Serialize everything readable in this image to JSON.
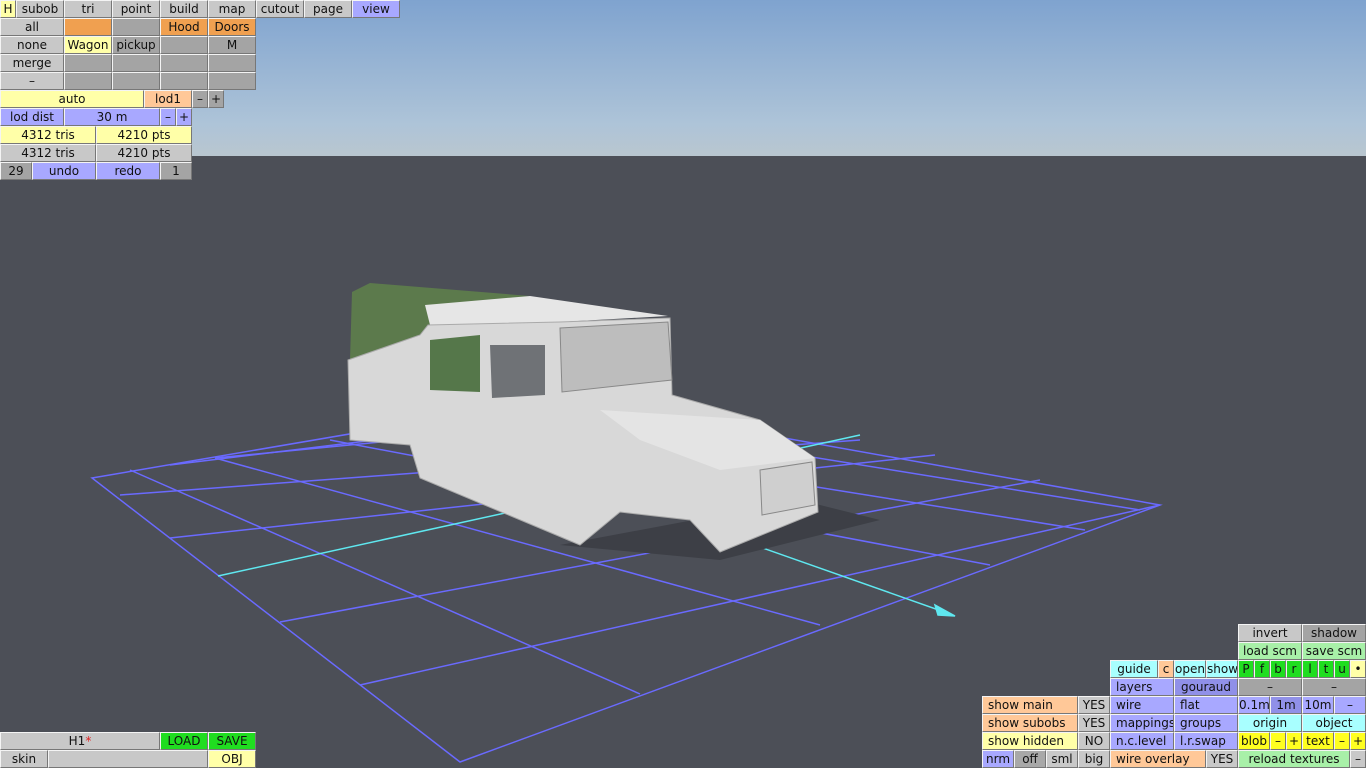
{
  "top_tabs": [
    "H",
    "subob",
    "tri",
    "point",
    "build",
    "map",
    "cutout",
    "page",
    "view"
  ],
  "subob_grid": {
    "all": "all",
    "none": "none",
    "merge": "merge",
    "dash": "–",
    "hood": "Hood",
    "doors": "Doors",
    "wagon": "Wagon",
    "pickup": "pickup",
    "m": "M"
  },
  "lod": {
    "auto": "auto",
    "level": "lod1",
    "minus": "–",
    "plus": "+",
    "dist_label": "lod dist",
    "dist_value": "30 m"
  },
  "stats": {
    "sel_tris": "4312 tris",
    "sel_pts": "4210 pts",
    "total_tris": "4312 tris",
    "total_pts": "4210 pts"
  },
  "history": {
    "undo_count": "29",
    "undo": "undo",
    "redo": "redo",
    "redo_count": "1"
  },
  "file": {
    "name": "H1",
    "modified_mark": "*",
    "load": "LOAD",
    "save": "SAVE",
    "skin": "skin",
    "skin_value": "",
    "obj": "OBJ"
  },
  "view_panel": {
    "invert": "invert",
    "shadow": "shadow",
    "load_scm": "load scm",
    "save_scm": "save scm",
    "guide": "guide",
    "c": "c",
    "open": "open",
    "show": "show",
    "views": [
      "P",
      "f",
      "b",
      "r",
      "l",
      "t",
      "u",
      "•"
    ],
    "layers": "layers",
    "gouraud": "gouraud",
    "dash": "–",
    "show_main": "show main",
    "show_main_val": "YES",
    "wire": "wire",
    "flat": "flat",
    "grid": [
      "0.1m",
      "1m",
      "10m",
      "–"
    ],
    "show_subobs": "show subobs",
    "show_subobs_val": "YES",
    "mappings": "mappings",
    "groups": "groups",
    "origin": "origin",
    "object": "object",
    "show_hidden": "show hidden",
    "show_hidden_val": "NO",
    "nclevel": "n.c.level",
    "lrswap": "l.r.swap",
    "blob": "blob",
    "text": "text",
    "minus": "–",
    "plus": "+",
    "sizes": [
      "nrm",
      "off",
      "sml",
      "big"
    ],
    "wire_overlay": "wire overlay",
    "wire_overlay_val": "YES",
    "reload_textures": "reload textures"
  }
}
